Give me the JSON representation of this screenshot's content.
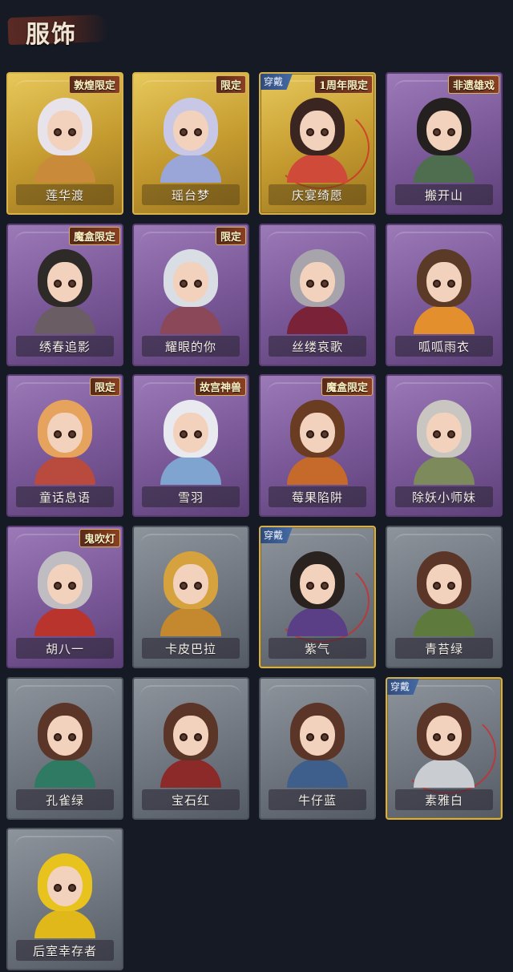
{
  "page": {
    "title": "服饰"
  },
  "outfits": [
    {
      "name": "莲华渡",
      "rarity": "gold",
      "badge": "敦煌限定",
      "equipped": false,
      "colors": {
        "hair": "#e8e2ea",
        "body": "#c98b3a"
      }
    },
    {
      "name": "瑶台梦",
      "rarity": "gold",
      "badge": "限定",
      "equipped": false,
      "colors": {
        "hair": "#c8c8e6",
        "body": "#9aa6d8"
      }
    },
    {
      "name": "庆宴绮愿",
      "rarity": "gold",
      "badge": "1周年限定",
      "equipped": true,
      "equip_label": "穿戴",
      "colors": {
        "hair": "#3a2520",
        "body": "#d04a3a"
      }
    },
    {
      "name": "搬开山",
      "rarity": "purple",
      "badge": "非遗雄戏",
      "equipped": false,
      "colors": {
        "hair": "#24201f",
        "body": "#4f6e50"
      }
    },
    {
      "name": "绣春追影",
      "rarity": "purple",
      "badge": "魔盒限定",
      "equipped": false,
      "colors": {
        "hair": "#2e2a28",
        "body": "#6a5d64"
      }
    },
    {
      "name": "耀眼的你",
      "rarity": "purple",
      "badge": "限定",
      "equipped": false,
      "colors": {
        "hair": "#d9dde4",
        "body": "#8a4858"
      }
    },
    {
      "name": "丝缕哀歌",
      "rarity": "purple",
      "badge": "",
      "equipped": false,
      "colors": {
        "hair": "#a7a4ab",
        "body": "#7a2238"
      }
    },
    {
      "name": "呱呱雨衣",
      "rarity": "purple",
      "badge": "",
      "equipped": false,
      "colors": {
        "hair": "#5b3a28",
        "body": "#e48f2e"
      }
    },
    {
      "name": "童话息语",
      "rarity": "purple",
      "badge": "限定",
      "equipped": false,
      "colors": {
        "hair": "#e6a35e",
        "body": "#b84a3e"
      }
    },
    {
      "name": "雪羽",
      "rarity": "purple",
      "badge": "故宫神兽",
      "equipped": false,
      "colors": {
        "hair": "#e9eaf0",
        "body": "#7fa4d0"
      }
    },
    {
      "name": "莓果陷阱",
      "rarity": "purple",
      "badge": "魔盒限定",
      "equipped": false,
      "colors": {
        "hair": "#6a3c22",
        "body": "#c56a2a"
      }
    },
    {
      "name": "除妖小师妹",
      "rarity": "purple",
      "badge": "",
      "equipped": false,
      "colors": {
        "hair": "#c9c6c2",
        "body": "#7c8a5c"
      }
    },
    {
      "name": "胡八一",
      "rarity": "purple",
      "badge": "鬼吹灯",
      "equipped": false,
      "colors": {
        "hair": "#bfbcc2",
        "body": "#b8342c"
      }
    },
    {
      "name": "卡皮巴拉",
      "rarity": "gray",
      "badge": "",
      "equipped": false,
      "colors": {
        "hair": "#d6a23e",
        "body": "#c4892e"
      }
    },
    {
      "name": "紫气",
      "rarity": "gray",
      "badge": "",
      "equipped": true,
      "equip_label": "穿戴",
      "colors": {
        "hair": "#2a221e",
        "body": "#5b3f86"
      }
    },
    {
      "name": "青苔绿",
      "rarity": "gray",
      "badge": "",
      "equipped": false,
      "colors": {
        "hair": "#5b3527",
        "body": "#5e7a3c"
      }
    },
    {
      "name": "孔雀绿",
      "rarity": "gray",
      "badge": "",
      "equipped": false,
      "colors": {
        "hair": "#5b3527",
        "body": "#2f7a62"
      }
    },
    {
      "name": "宝石红",
      "rarity": "gray",
      "badge": "",
      "equipped": false,
      "colors": {
        "hair": "#5b3527",
        "body": "#8c2a2a"
      }
    },
    {
      "name": "牛仔蓝",
      "rarity": "gray",
      "badge": "",
      "equipped": false,
      "colors": {
        "hair": "#5b3527",
        "body": "#3e5f8c"
      }
    },
    {
      "name": "素雅白",
      "rarity": "gray",
      "badge": "",
      "equipped": true,
      "equip_label": "穿戴",
      "colors": {
        "hair": "#5b3527",
        "body": "#c9ccd0"
      }
    },
    {
      "name": "后室幸存者",
      "rarity": "gray",
      "badge": "",
      "equipped": false,
      "colors": {
        "hair": "#e8c31e",
        "body": "#e0b81a"
      }
    }
  ]
}
